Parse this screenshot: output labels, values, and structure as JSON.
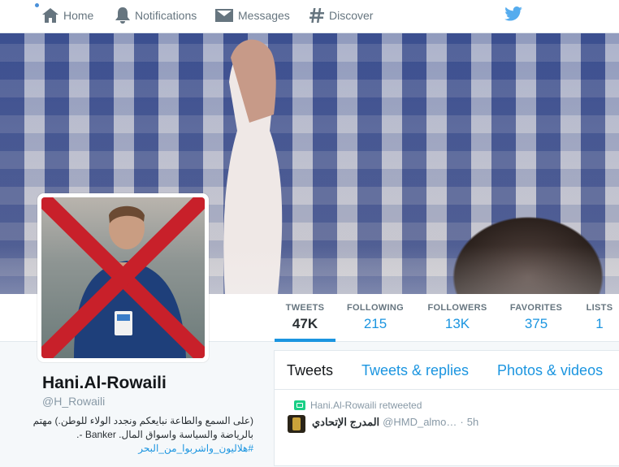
{
  "nav": {
    "home_label": "Home",
    "notifications_label": "Notifications",
    "messages_label": "Messages",
    "discover_label": "Discover"
  },
  "colors": {
    "accent": "#1b95e0",
    "retweet": "#19cf86",
    "cross": "#c8202a"
  },
  "stats": [
    {
      "label": "TWEETS",
      "value": "47K",
      "active": true
    },
    {
      "label": "FOLLOWING",
      "value": "215"
    },
    {
      "label": "FOLLOWERS",
      "value": "13K"
    },
    {
      "label": "FAVORITES",
      "value": "375"
    },
    {
      "label": "LISTS",
      "value": "1"
    }
  ],
  "profile": {
    "name": "Hani.Al-Rowaili",
    "handle": "@H_Rowaili",
    "bio_line1": "(على السمع والطاعة نبايعكم ونجدد الولاء للوطن.) مهتم",
    "bio_line2": "بالرياضة والسياسة واسواق المال. Banker -.",
    "bio_hashtag": "#هلاليون_واشربوا_من_البحر"
  },
  "timeline": {
    "tabs": [
      "Tweets",
      "Tweets & replies",
      "Photos & videos"
    ],
    "active_tab": "Tweets",
    "tweet": {
      "retweet_text": "Hani.Al-Rowaili retweeted",
      "author_name": "المدرج الإتحادي",
      "author_handle": "@HMD_almo…",
      "separator": "·",
      "time": "5h"
    }
  }
}
